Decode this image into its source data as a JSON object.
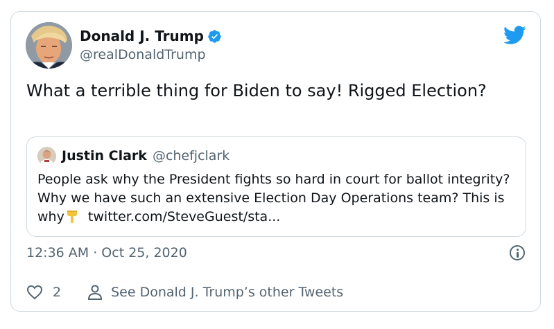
{
  "author": {
    "name": "Donald J. Trump",
    "handle": "@realDonaldTrump",
    "verified": true
  },
  "tweet": {
    "text": "What a terrible thing for Biden to say! Rigged Election?"
  },
  "quoted_tweet": {
    "name": "Justin Clark",
    "handle": "@chefjclark",
    "text": "People ask why the President fights so hard in court for ballot integrity?  Why we have such an extensive Election Day Operations team? This is why",
    "emoji": "pointing-down-hand",
    "link": "twitter.com/SteveGuest/sta..."
  },
  "meta": {
    "timestamp": "12:36 AM · Oct 25, 2020"
  },
  "actions": {
    "like_count": "2",
    "see_other": "See Donald J. Trump’s other Tweets"
  },
  "colors": {
    "twitter_blue": "#1d9bf0",
    "secondary_text": "#536471",
    "border": "#cfd9de",
    "emoji_yellow": "#f5c33b"
  }
}
